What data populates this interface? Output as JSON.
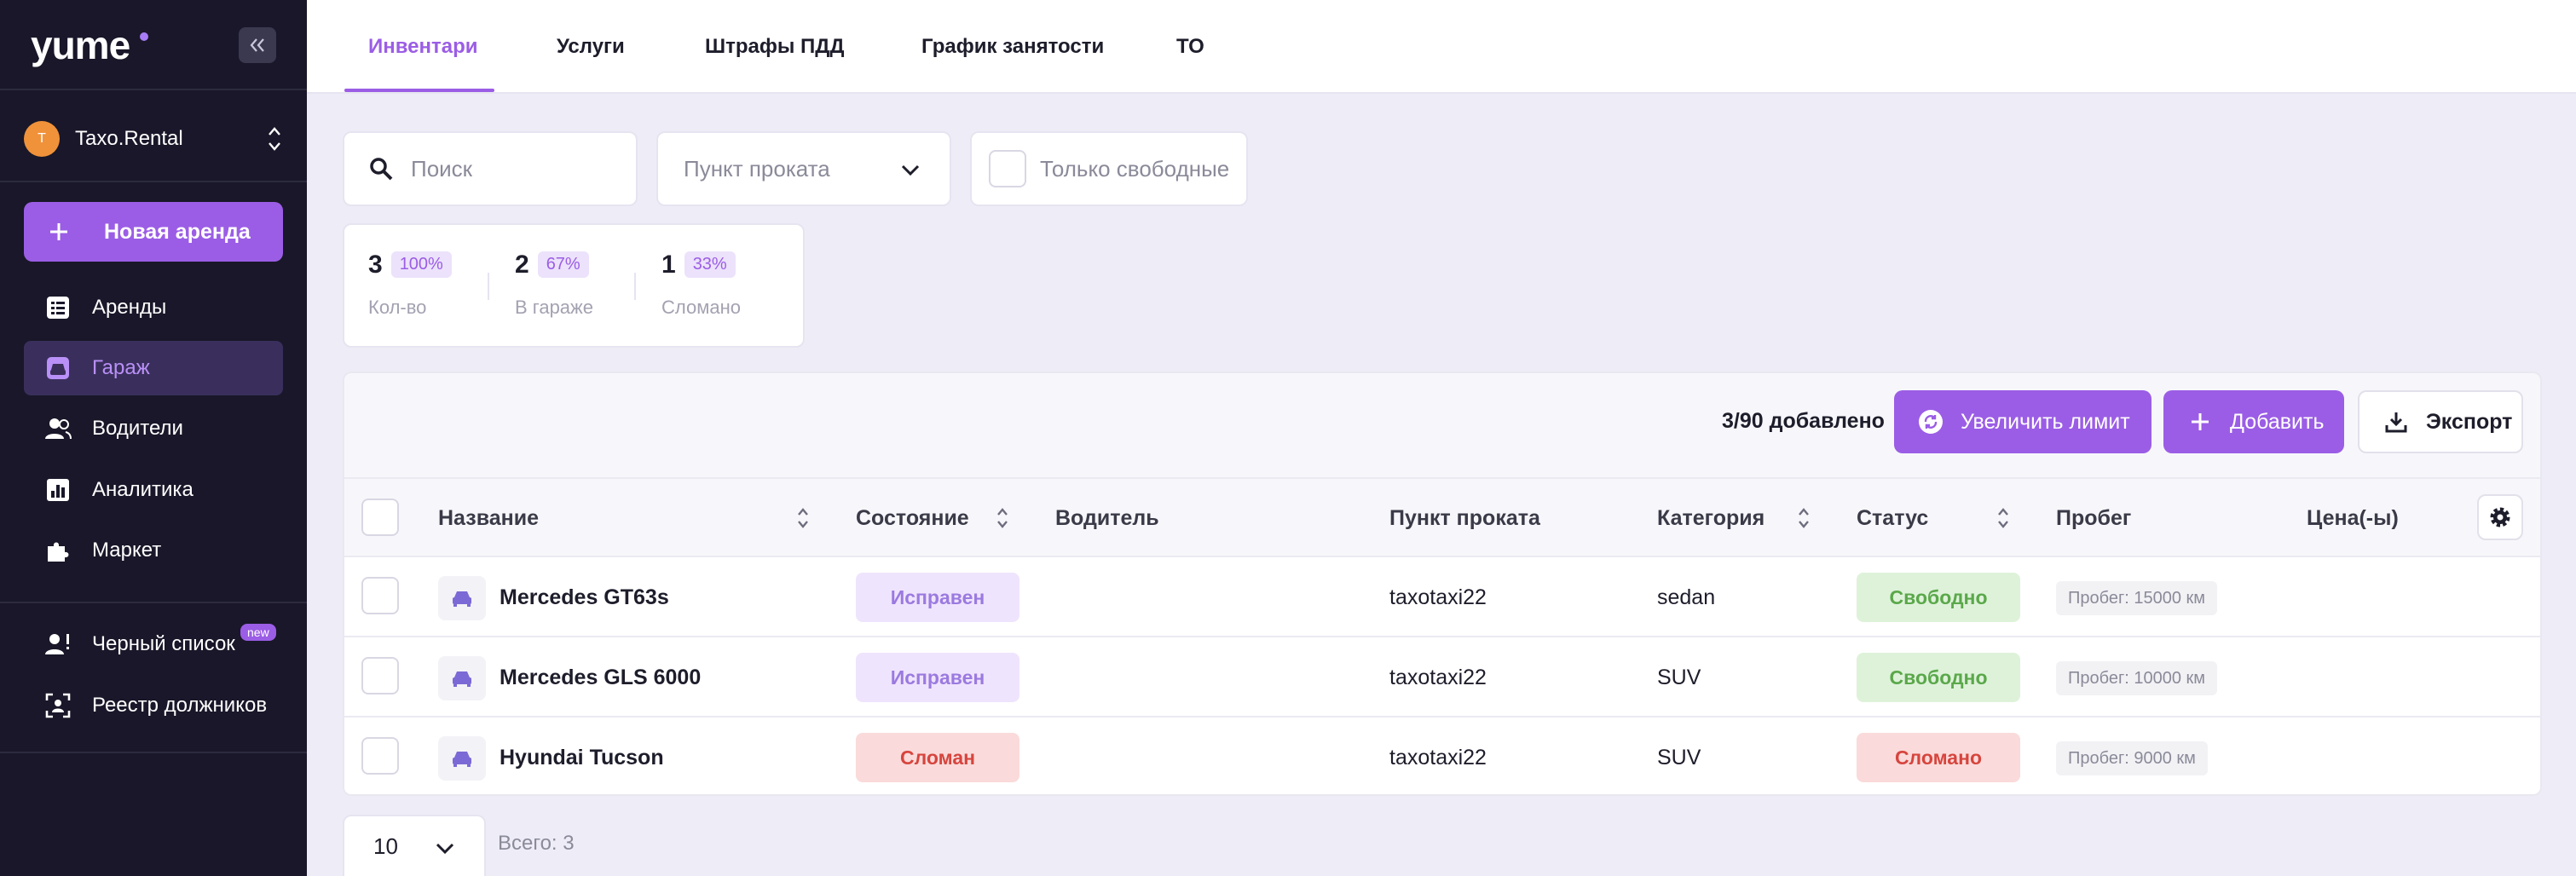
{
  "sidebar": {
    "logo": "yume",
    "company": {
      "initial": "T",
      "name": "Taxo.Rental"
    },
    "new_rental": "Новая аренда",
    "items": [
      {
        "label": "Аренды",
        "icon": "list-icon"
      },
      {
        "label": "Гараж",
        "icon": "car-icon",
        "active": true
      },
      {
        "label": "Водители",
        "icon": "users-icon"
      },
      {
        "label": "Аналитика",
        "icon": "chart-icon"
      },
      {
        "label": "Маркет",
        "icon": "puzzle-icon"
      }
    ],
    "items2": [
      {
        "label": "Черный список",
        "icon": "user-alert-icon",
        "badge": "new"
      },
      {
        "label": "Реестр должников",
        "icon": "face-scan-icon"
      }
    ]
  },
  "tabs": [
    "Инвентари",
    "Услуги",
    "Штрафы ПДД",
    "График занятости",
    "ТО"
  ],
  "filters": {
    "search_placeholder": "Поиск",
    "point_placeholder": "Пункт проката",
    "free_only": "Только свободные"
  },
  "stats": [
    {
      "value": "3",
      "percent": "100%",
      "caption": "Кол-во"
    },
    {
      "value": "2",
      "percent": "67%",
      "caption": "В гараже"
    },
    {
      "value": "1",
      "percent": "33%",
      "caption": "Сломано"
    }
  ],
  "toolbar": {
    "count": "3/90 добавлено",
    "increase_limit": "Увеличить лимит",
    "add": "Добавить",
    "export": "Экспорт"
  },
  "table": {
    "columns": [
      "Название",
      "Состояние",
      "Водитель",
      "Пункт проката",
      "Категория",
      "Статус",
      "Пробег",
      "Цена(-ы)"
    ],
    "rows": [
      {
        "name": "Mercedes GT63s",
        "condition": "Исправен",
        "driver": "",
        "point": "taxotaxi22",
        "category": "sedan",
        "status": "Свободно",
        "mileage": "Пробег: 15000 км",
        "price": ""
      },
      {
        "name": "Mercedes GLS 6000",
        "condition": "Исправен",
        "driver": "",
        "point": "taxotaxi22",
        "category": "SUV",
        "status": "Свободно",
        "mileage": "Пробег: 10000 км",
        "price": ""
      },
      {
        "name": "Hyundai Tucson",
        "condition": "Сломан",
        "driver": "",
        "point": "taxotaxi22",
        "category": "SUV",
        "status": "Сломано",
        "mileage": "Пробег: 9000 км",
        "price": ""
      }
    ]
  },
  "pagination": {
    "page_size": "10",
    "total": "Всего: 3"
  },
  "colors": {
    "accent": "#9b5de5",
    "sidebar_bg": "#191729",
    "ok_bg": "#def2da",
    "broken_bg": "#fadada"
  }
}
